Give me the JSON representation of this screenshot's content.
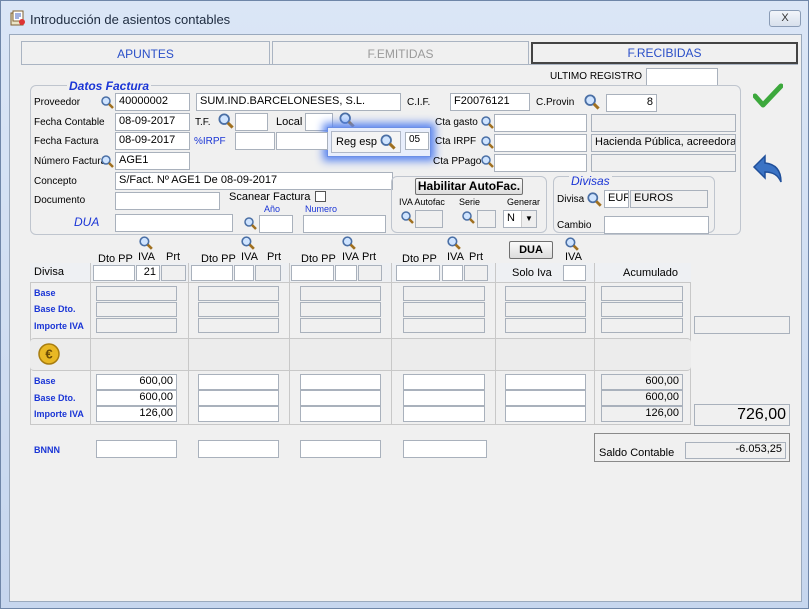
{
  "window": {
    "title": "Introducción de asientos contables",
    "close_label": "X"
  },
  "tabs": [
    {
      "label": "APUNTES"
    },
    {
      "label": "F.EMITIDAS"
    },
    {
      "label": "F.RECIBIDAS"
    }
  ],
  "ultimo_registro": {
    "label": "ULTIMO REGISTRO",
    "value": ""
  },
  "datos_factura": {
    "title": "Datos Factura",
    "proveedor_label": "Proveedor",
    "proveedor_code": "40000002",
    "proveedor_name": "SUM.IND.BARCELONESES, S.L.",
    "cif_label": "C.I.F.",
    "cif_value": "F20076121",
    "cprovin_label": "C.Provin",
    "cprovin_value": "8",
    "fecha_contable_label": "Fecha Contable",
    "fecha_contable": "08-09-2017",
    "tf_label": "T.F.",
    "tf_value": "",
    "local_label": "Local",
    "reg_esp_label": "Reg esp",
    "reg_esp_value": "05",
    "fecha_factura_label": "Fecha Factura",
    "fecha_factura": "08-09-2017",
    "irpf_label": "%IRPF",
    "cta_gasto_label": "Cta gasto",
    "cta_irpf_label": "Cta  IRPF",
    "cta_irpf_desc": "Hacienda Pública, acreedora",
    "cta_ppago_label": "Cta PPago",
    "numero_factura_label": "Número Factura",
    "numero_factura": "AGE1",
    "concepto_label": "Concepto",
    "concepto": "S/Fact. Nº AGE1 De 08-09-2017",
    "documento_label": "Documento",
    "scanear_label": "Scanear Factura",
    "dua_label": "DUA",
    "ano_label": "Año",
    "numero_label": "Numero"
  },
  "autofac": {
    "button": "Habilitar AutoFac.",
    "iva_autofac_label": "IVA Autofac",
    "serie_label": "Serie",
    "generar_label": "Generar",
    "generar_value": "N"
  },
  "divisas": {
    "title": "Divisas",
    "divisa_label": "Divisa",
    "divisa_code": "EUR",
    "divisa_name": "EUROS",
    "cambio_label": "Cambio"
  },
  "grid": {
    "dto_pp": "Dto PP",
    "iva": "IVA",
    "prt": "Prt",
    "dua_button": "DUA",
    "divisa_label": "Divisa",
    "first_iva": "21",
    "solo_iva": "Solo Iva",
    "acumulado": "Acumulado",
    "row_base": "Base",
    "row_base_dto": "Base Dto.",
    "row_importe_iva": "Importe IVA",
    "col1_base": "600,00",
    "col1_base_dto": "600,00",
    "col1_importe_iva": "126,00",
    "acum_base": "600,00",
    "acum_base_dto": "600,00",
    "acum_importe_iva": "126,00",
    "total": "726,00",
    "bnnn": "BNNN"
  },
  "saldo": {
    "label": "Saldo Contable",
    "value": "-6.053,25"
  },
  "icons": [
    "app-icon",
    "search-icon",
    "checkmark-icon",
    "undo-arrow-icon",
    "euro-coin-icon",
    "dropdown-icon"
  ]
}
